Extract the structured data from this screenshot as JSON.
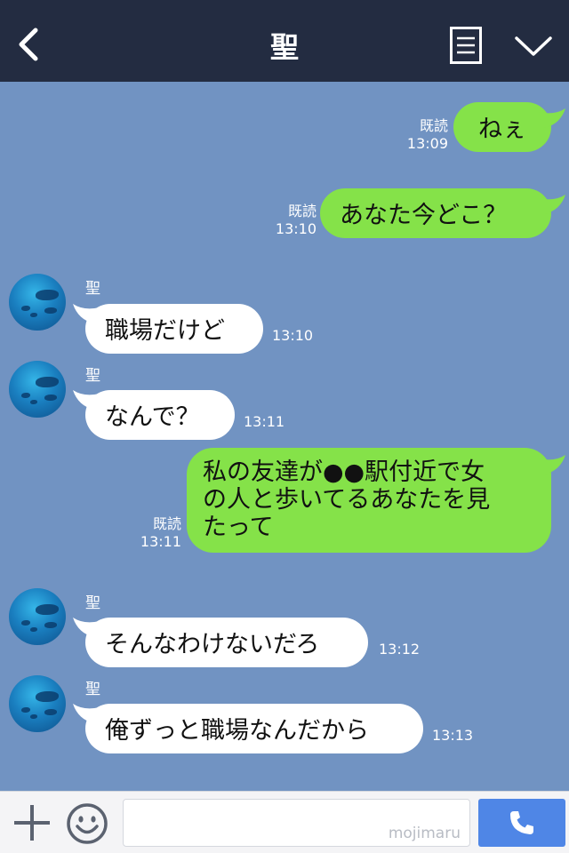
{
  "header": {
    "title": "聖",
    "back_icon": "chevron-left-icon",
    "menu_icon": "list-icon",
    "collapse_icon": "chevron-down-icon"
  },
  "messages": [
    {
      "side": "me",
      "text": "ねぇ",
      "read": "既読",
      "time": "13:09"
    },
    {
      "side": "me",
      "text": "あなた今どこ？",
      "read": "既読",
      "time": "13:10"
    },
    {
      "side": "them",
      "sender": "聖",
      "text": "職場だけど",
      "time": "13:10"
    },
    {
      "side": "them",
      "sender": "聖",
      "text": "なんで？",
      "time": "13:11"
    },
    {
      "side": "me",
      "lines": [
        "私の友達が●●駅付近で女",
        "の人と歩いてるあなたを見",
        "たって"
      ],
      "read": "既読",
      "time": "13:11"
    },
    {
      "side": "them",
      "sender": "聖",
      "text": "そんなわけないだろ",
      "time": "13:12"
    },
    {
      "side": "them",
      "sender": "聖",
      "text": "俺ずっと職場なんだから",
      "time": "13:13"
    }
  ],
  "input": {
    "placeholder": "",
    "watermark": "mojimaru",
    "plus_icon": "plus-icon",
    "emoji_icon": "smiley-icon",
    "call_icon": "phone-icon"
  },
  "colors": {
    "header_bg": "#232c41",
    "chat_bg": "#7193c2",
    "my_bubble": "#85e249",
    "their_bubble": "#ffffff",
    "call_button": "#4f86e6"
  }
}
